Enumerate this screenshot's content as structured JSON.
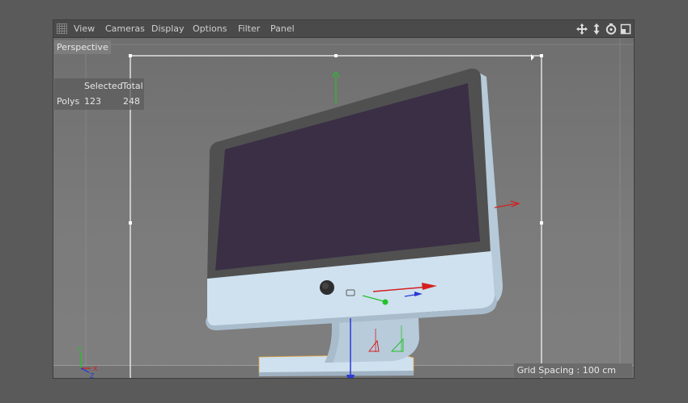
{
  "menu": {
    "items": [
      "View",
      "Cameras",
      "Display",
      "Options",
      "Filter",
      "Panel"
    ]
  },
  "nav_icons": [
    "move-icon",
    "zoom-icon",
    "rotate-icon",
    "toggle-view-icon"
  ],
  "viewport": {
    "label": "Perspective",
    "stats": {
      "col_selected": "Selected",
      "col_total": "Total",
      "row_label": "Polys",
      "selected_value": "123",
      "total_value": "248"
    },
    "grid_spacing": "Grid Spacing : 100 cm"
  },
  "colors": {
    "screen": "#3a2f45",
    "bezel": "#525252",
    "body": "#cfe1ef",
    "x_axis": "#d42020",
    "y_axis": "#22c22a",
    "z_axis": "#2a3ad4"
  }
}
